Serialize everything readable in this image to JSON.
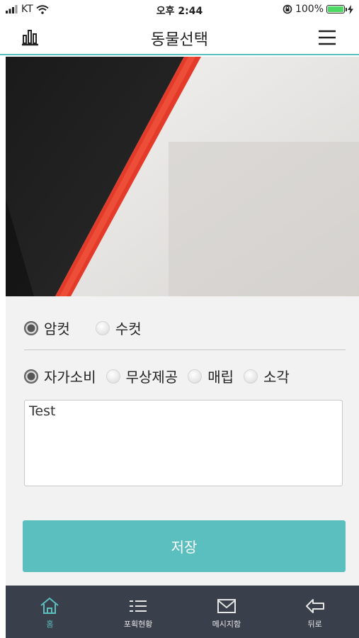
{
  "status": {
    "carrier": "KT",
    "time": "오후 2:44",
    "battery": "100%",
    "battery_level": 1.0
  },
  "header": {
    "title": "동물선택",
    "left_icon": "bar-chart-icon",
    "right_icon": "menu-icon"
  },
  "sex": {
    "options": [
      {
        "label": "암컷",
        "selected": true
      },
      {
        "label": "수컷",
        "selected": false
      }
    ]
  },
  "usage": {
    "options": [
      {
        "label": "자가소비",
        "selected": true
      },
      {
        "label": "무상제공",
        "selected": false
      },
      {
        "label": "매립",
        "selected": false
      },
      {
        "label": "소각",
        "selected": false
      }
    ]
  },
  "memo": {
    "value": "Test"
  },
  "save_label": "저장",
  "tabs": [
    {
      "label": "홈",
      "icon": "home-icon",
      "active": true
    },
    {
      "label": "포획현황",
      "icon": "list-icon",
      "active": false
    },
    {
      "label": "메시지함",
      "icon": "mail-icon",
      "active": false
    },
    {
      "label": "뒤로",
      "icon": "back-arrow-icon",
      "active": false
    }
  ],
  "colors": {
    "accent": "#5bbfbf",
    "tab_bar": "#3a3f4c",
    "form_bg": "#f2f2f2"
  }
}
